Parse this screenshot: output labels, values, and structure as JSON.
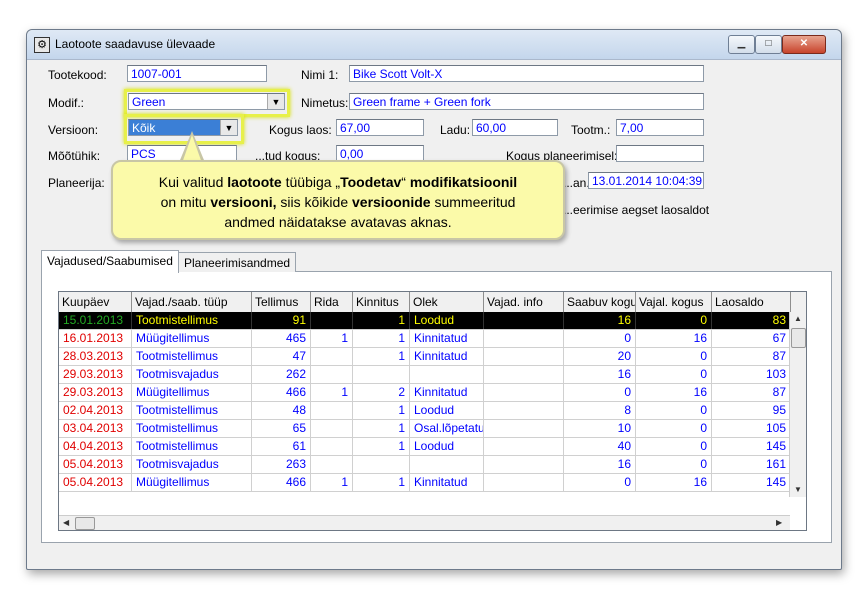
{
  "window": {
    "title": "Laotoote saadavuse ülevaade"
  },
  "form": {
    "tootekood_label": "Tootekood:",
    "tootekood": "1007-001",
    "nimi1_label": "Nimi 1:",
    "nimi1": "Bike Scott Volt-X",
    "modif_label": "Modif.:",
    "modif": "Green",
    "nimetus_label": "Nimetus:",
    "nimetus": "Green frame + Green fork",
    "versioon_label": "Versioon:",
    "versioon": "Kõik",
    "kogus_laos_label": "Kogus laos:",
    "kogus_laos": "67,00",
    "ladu_label": "Ladu:",
    "ladu": "60,00",
    "tootm_label": "Tootm.:",
    "tootm": "7,00",
    "mootuhik_label": "Mõõtühik:",
    "mootuhik": "PCS",
    "kinnitatud_label": "...tud kogus:",
    "kinnitatud": "0,00",
    "kogus_planeerimisel_label": "Kogus planeerimisel:",
    "kogus_planeerimisel": "",
    "planeerija_label": "Planeerija:",
    "aeg_label": "...an.:",
    "aeg": "13.01.2014 10:04:39",
    "saldo_label": "...eerimise aegset laosaldot"
  },
  "callout": {
    "line1_a": "Kui valitud ",
    "line1_b": "laotoote",
    "line1_c": " tüübiga „",
    "line1_d": "Toodetav",
    "line1_e": "“ ",
    "line1_f": "modifikatsioonil",
    "line2_a": "on mitu ",
    "line2_b": "versiooni,",
    "line2_c": " siis kõikide ",
    "line2_d": "versioonide",
    "line2_e": " summeeritud",
    "line3": "andmed näidatakse avatavas aknas."
  },
  "tabs": [
    "Vajadused/Saabumised",
    "Planeerimisandmed"
  ],
  "grid": {
    "columns": [
      "Kuupäev",
      "Vajad./saab. tüüp",
      "Tellimus",
      "Rida",
      "Kinnitus",
      "Olek",
      "Vajad. info",
      "Saabuv kogu",
      "Vajal. kogus",
      "Laosaldo"
    ],
    "rows": [
      [
        "15.01.2013",
        "Tootmistellimus",
        "91",
        "",
        "1",
        "Loodud",
        "",
        "16",
        "0",
        "83"
      ],
      [
        "16.01.2013",
        "Müügitellimus",
        "465",
        "1",
        "1",
        "Kinnitatud",
        "",
        "0",
        "16",
        "67"
      ],
      [
        "28.03.2013",
        "Tootmistellimus",
        "47",
        "",
        "1",
        "Kinnitatud",
        "",
        "20",
        "0",
        "87"
      ],
      [
        "29.03.2013",
        "Tootmisvajadus",
        "262",
        "",
        "",
        "",
        "",
        "16",
        "0",
        "103"
      ],
      [
        "29.03.2013",
        "Müügitellimus",
        "466",
        "1",
        "2",
        "Kinnitatud",
        "",
        "0",
        "16",
        "87"
      ],
      [
        "02.04.2013",
        "Tootmistellimus",
        "48",
        "",
        "1",
        "Loodud",
        "",
        "8",
        "0",
        "95"
      ],
      [
        "03.04.2013",
        "Tootmistellimus",
        "65",
        "",
        "1",
        "Osal.lõpetatu",
        "",
        "10",
        "0",
        "105"
      ],
      [
        "04.04.2013",
        "Tootmistellimus",
        "61",
        "",
        "1",
        "Loodud",
        "",
        "40",
        "0",
        "145"
      ],
      [
        "05.04.2013",
        "Tootmisvajadus",
        "263",
        "",
        "",
        "",
        "",
        "16",
        "0",
        "161"
      ],
      [
        "05.04.2013",
        "Müügitellimus",
        "466",
        "1",
        "1",
        "Kinnitatud",
        "",
        "0",
        "16",
        "145"
      ]
    ]
  },
  "colors": {
    "date_red": "#e00000",
    "date_green": "#22aa22",
    "highlight_yellow": "#e7f04a",
    "callout_bg": "#fbfaa9"
  }
}
